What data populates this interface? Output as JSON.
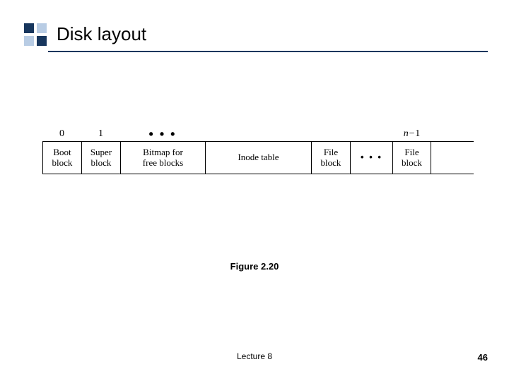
{
  "title": "Disk layout",
  "diagram": {
    "topLabels": {
      "col0": "0",
      "col1": "1",
      "ellipsisTop": "• • •",
      "last_n": "n",
      "last_minus": "−",
      "last_one": "1"
    },
    "cells": {
      "boot_l1": "Boot",
      "boot_l2": "block",
      "super_l1": "Super",
      "super_l2": "block",
      "bitmap_l1": "Bitmap for",
      "bitmap_l2": "free blocks",
      "inode_l1": "Inode table",
      "file1_l1": "File",
      "file1_l2": "block",
      "ellipsis": "• • •",
      "file2_l1": "File",
      "file2_l2": "block"
    },
    "widths": {
      "w0": 55,
      "w1": 55,
      "w2": 120,
      "w3": 150,
      "w4": 55,
      "w5": 60,
      "w6": 55
    }
  },
  "caption": "Figure 2.20",
  "footer": "Lecture 8",
  "page": "46"
}
